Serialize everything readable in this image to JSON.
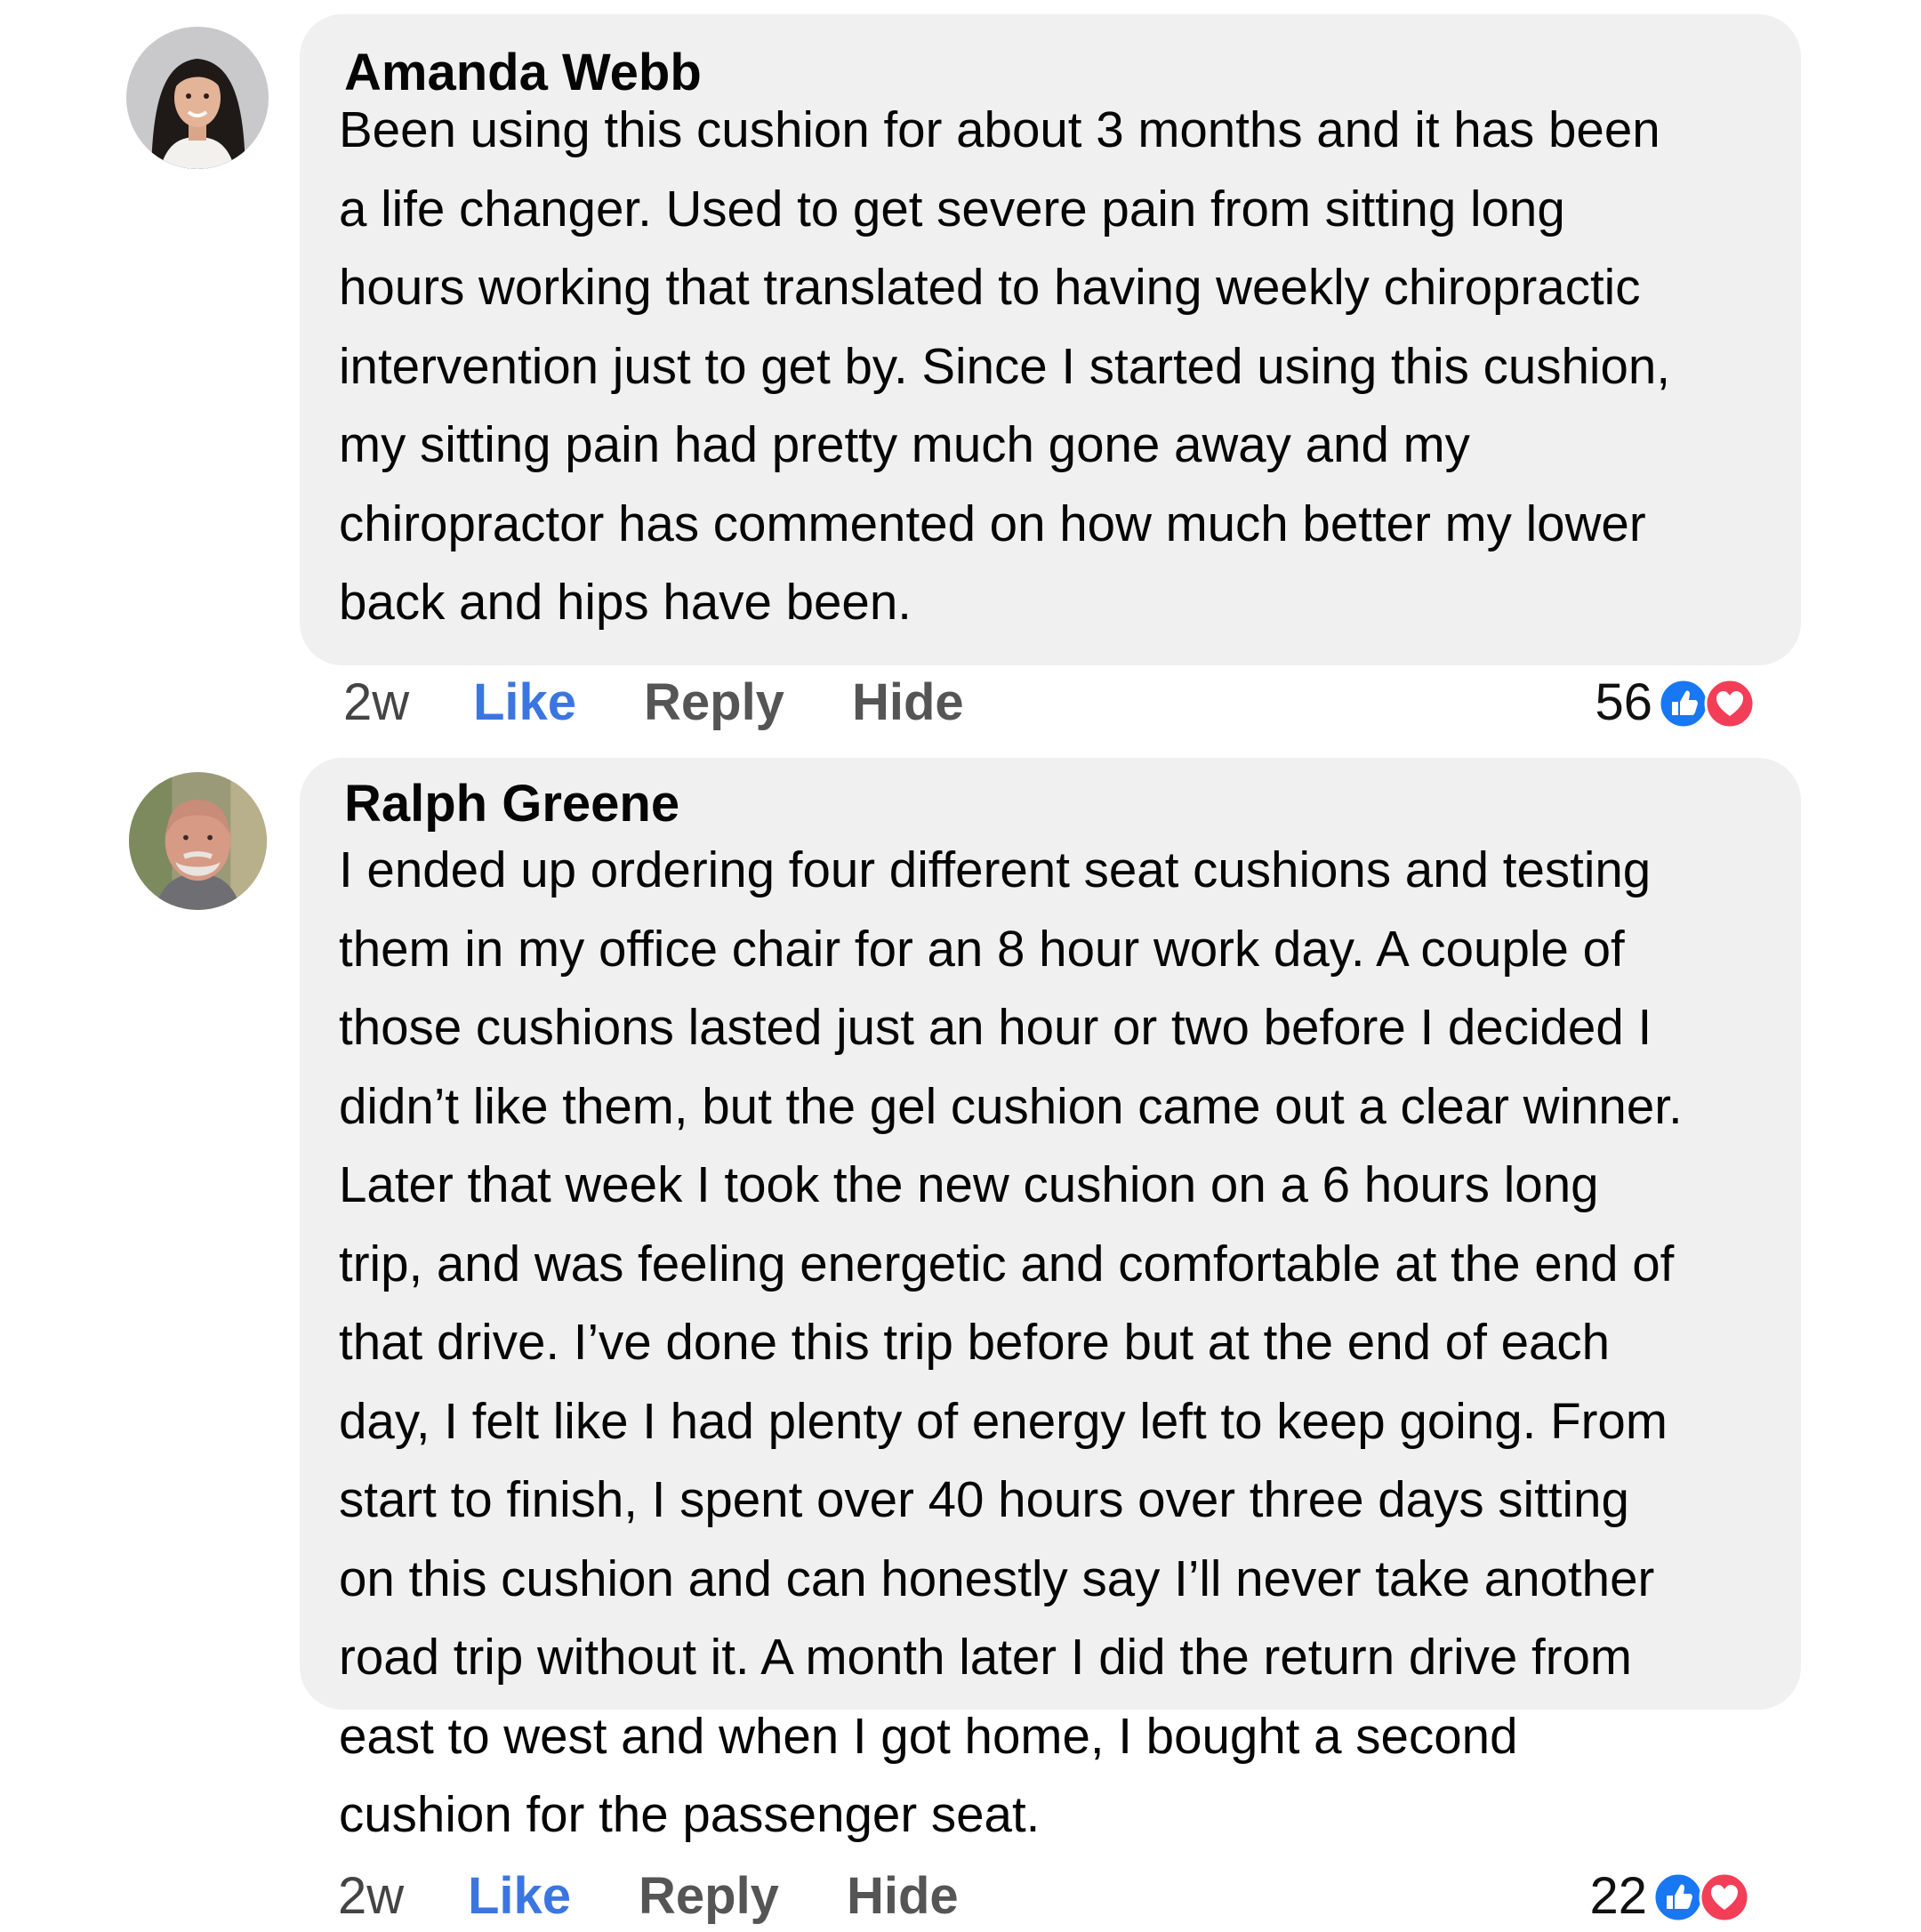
{
  "colors": {
    "bubble": "#f0f0f0",
    "like_active": "#3b76e0",
    "like_icon": "#1877f2",
    "love_icon": "#f33e58"
  },
  "comments": [
    {
      "author": "Amanda Webb",
      "lines": [
        "Been using this cushion for about 3 months and it has been",
        "a life changer. Used to get severe pain from sitting long",
        "hours working that translated to having weekly chiropractic",
        "intervention just to get by. Since I started using this cushion,",
        "my sitting pain had pretty much gone away and my",
        "chiropractor has commented on how much better my lower",
        "back and hips have been."
      ],
      "time": "2w",
      "like": "Like",
      "reply": "Reply",
      "hide": "Hide",
      "reactions": {
        "count": "56",
        "icons": [
          "like-icon",
          "love-icon"
        ]
      }
    },
    {
      "author": "Ralph Greene",
      "lines": [
        "I ended up ordering four different seat cushions and testing",
        "them in my office chair for an 8 hour work day. A couple of",
        "those cushions lasted just an hour or two before I decided I",
        "didn’t like them, but the gel cushion came out a clear winner.",
        "Later that week I took the new cushion on a 6 hours long",
        "trip, and was feeling energetic and comfortable at the end of",
        "that drive. I’ve done this trip before but at the end of each",
        "day, I felt like I had plenty of energy left to keep going. From",
        "start to finish, I spent over 40 hours over three days sitting",
        "on this cushion and can honestly say I’ll never take another",
        "road trip without it. A month later I did the return drive from",
        "east to west and when I got home, I bought a second",
        "cushion for the passenger seat."
      ],
      "time": "2w",
      "like": "Like",
      "reply": "Reply",
      "hide": "Hide",
      "reactions": {
        "count": "22",
        "icons": [
          "like-icon",
          "love-icon"
        ]
      }
    }
  ]
}
